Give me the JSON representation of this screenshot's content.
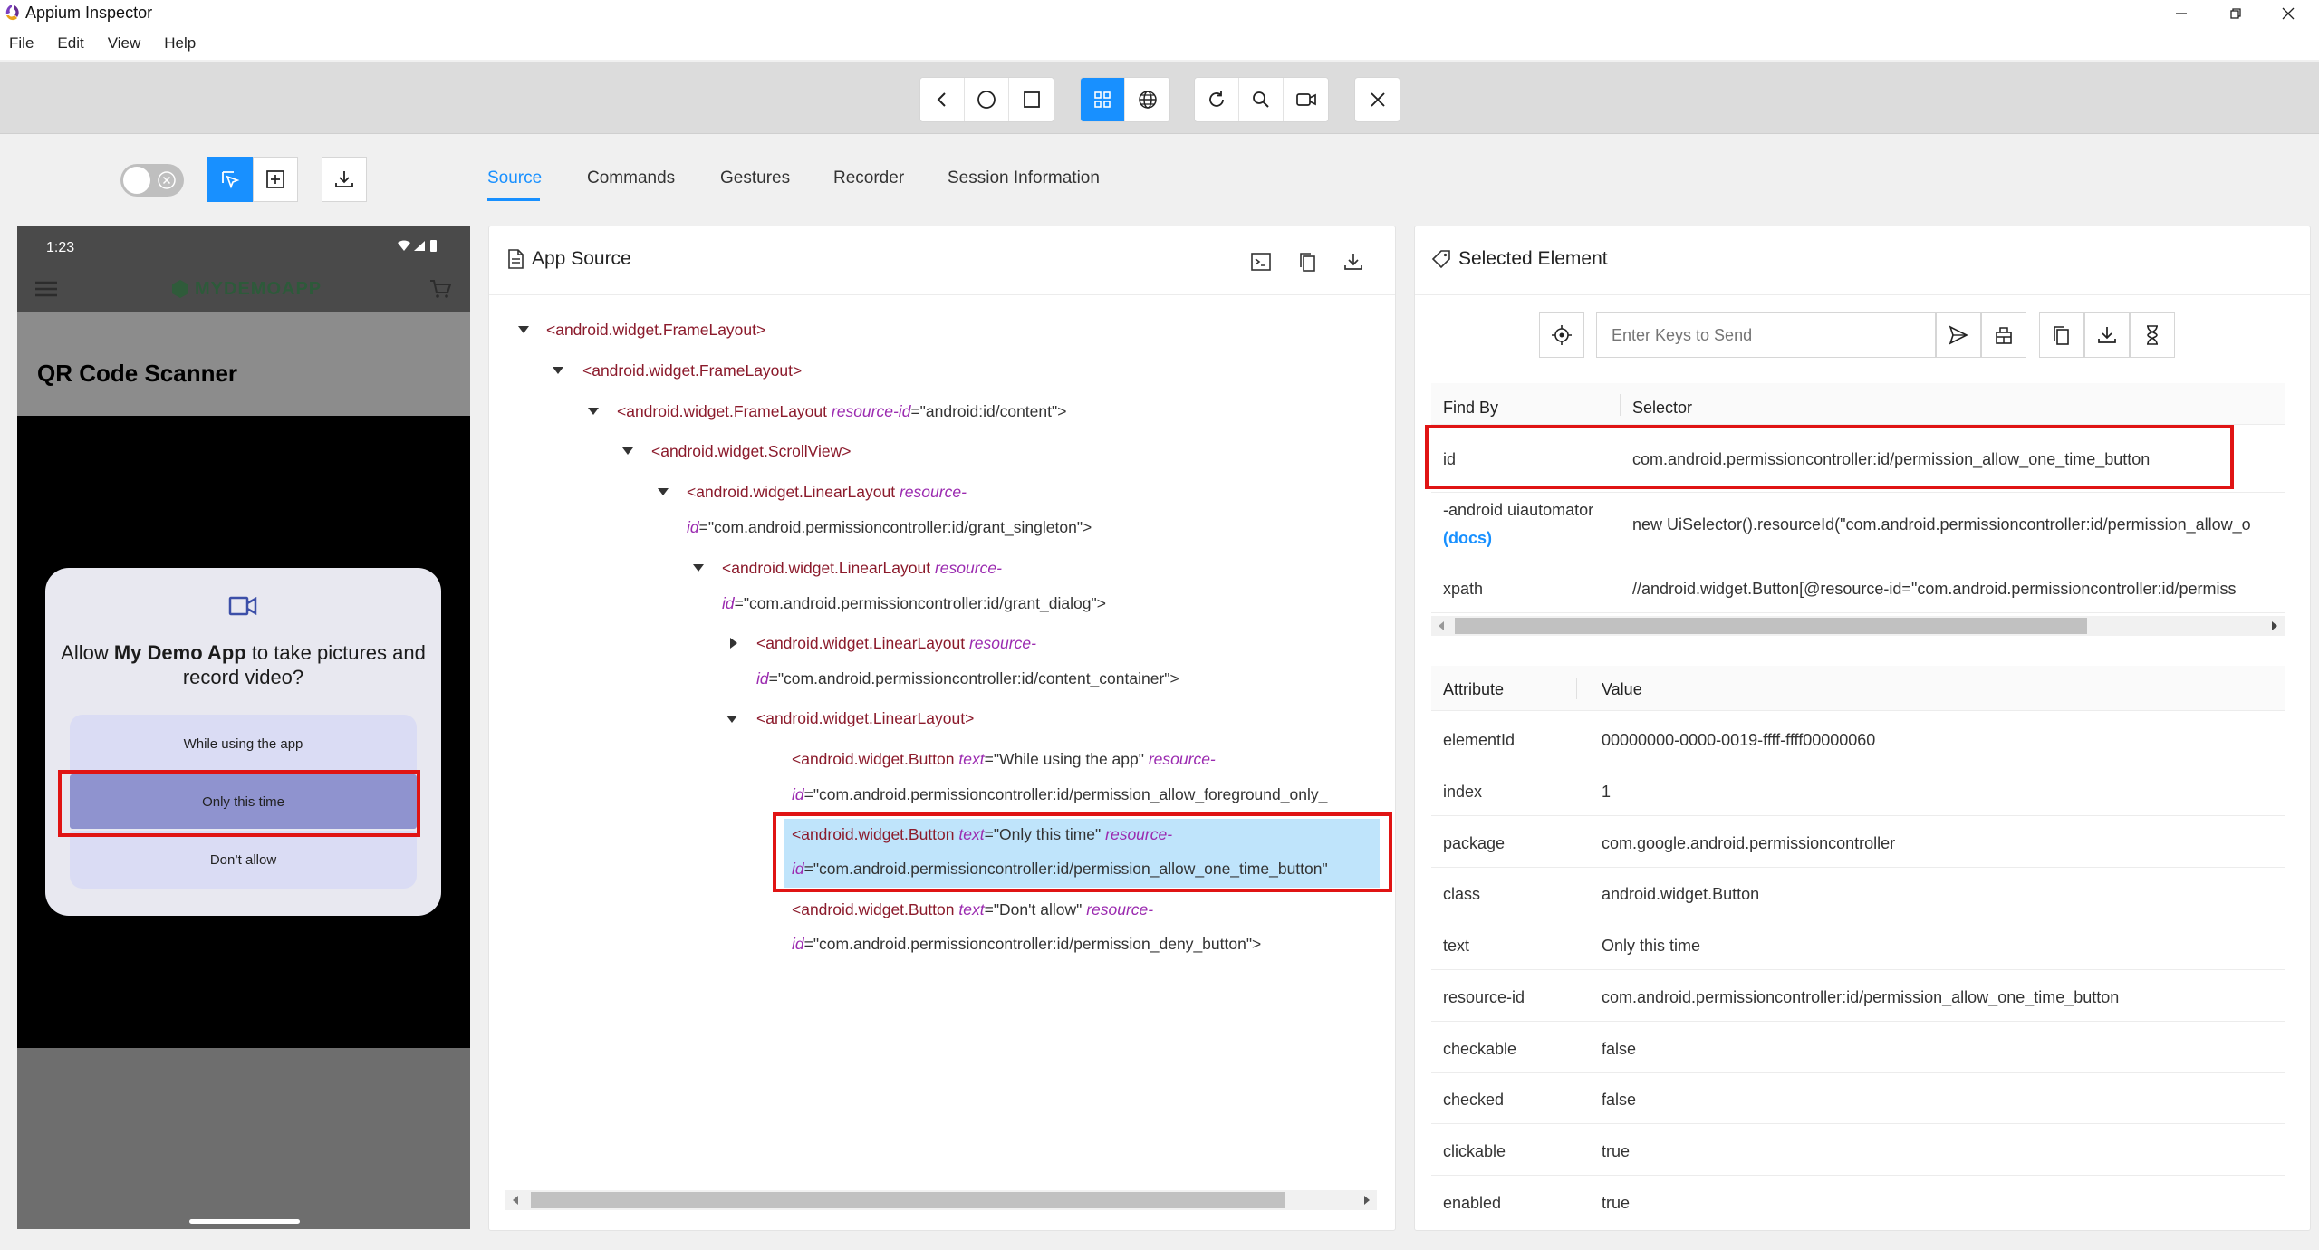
{
  "window": {
    "title": "Appium Inspector"
  },
  "menu": [
    "File",
    "Edit",
    "View",
    "Help"
  ],
  "tabs": [
    "Source",
    "Commands",
    "Gestures",
    "Recorder",
    "Session Information"
  ],
  "device": {
    "time": "1:23",
    "brand": "MYDEMOAPP",
    "screen_title": "QR Code Scanner",
    "dialog": {
      "prefix": "Allow ",
      "app_name": "My Demo App",
      "suffix": " to take pictures and record video?",
      "buttons": [
        "While using the app",
        "Only this time",
        "Don’t allow"
      ]
    }
  },
  "app_source": {
    "title": "App Source",
    "nodes": [
      {
        "tag": "<android.widget.FrameLayout>"
      },
      {
        "tag": "<android.widget.FrameLayout>"
      },
      {
        "tag": "<android.widget.FrameLayout",
        "attr": "resource-id",
        "val": "=\"android:id/content\">"
      },
      {
        "tag": "<android.widget.ScrollView>"
      },
      {
        "tag": "<android.widget.LinearLayout",
        "attr": "resource-",
        "attr2": "id",
        "val2": "=\"com.android.permissioncontroller:id/grant_singleton\">"
      },
      {
        "tag": "<android.widget.LinearLayout",
        "attr": "resource-",
        "attr2": "id",
        "val2": "=\"com.android.permissioncontroller:id/grant_dialog\">"
      },
      {
        "tag": "<android.widget.LinearLayout",
        "attr": "resource-",
        "attr2": "id",
        "val2": "=\"com.android.permissioncontroller:id/content_container\">"
      },
      {
        "tag": "<android.widget.LinearLayout>"
      },
      {
        "tag": "<android.widget.Button",
        "attr": "text",
        "val": "=\"While using the app\"",
        "attr_b": "resource-",
        "attr2": "id",
        "val2": "=\"com.android.permissioncontroller:id/permission_allow_foreground_only_"
      },
      {
        "tag": "<android.widget.Button",
        "attr": "text",
        "val": "=\"Only this time\"",
        "attr_b": "resource-",
        "attr2": "id",
        "val2": "=\"com.android.permissioncontroller:id/permission_allow_one_time_button\""
      },
      {
        "tag": "<android.widget.Button",
        "attr": "text",
        "val": "=\"Don't allow\"",
        "attr_b": "resource-",
        "attr2": "id",
        "val2": "=\"com.android.permissioncontroller:id/permission_deny_button\">"
      }
    ]
  },
  "selected_element": {
    "title": "Selected Element",
    "keys_placeholder": "Enter Keys to Send",
    "find_by_header": "Find By",
    "selector_header": "Selector",
    "selectors": [
      {
        "by": "id",
        "value": "com.android.permissioncontroller:id/permission_allow_one_time_button"
      },
      {
        "by": "-android uiautomator",
        "docs": "(docs)",
        "value": "new UiSelector().resourceId(\"com.android.permissioncontroller:id/permission_allow_o"
      },
      {
        "by": "xpath",
        "value": "//android.widget.Button[@resource-id=\"com.android.permissioncontroller:id/permiss"
      }
    ],
    "attribute_header": "Attribute",
    "value_header": "Value",
    "attributes": [
      {
        "name": "elementId",
        "value": "00000000-0000-0019-ffff-ffff00000060"
      },
      {
        "name": "index",
        "value": "1"
      },
      {
        "name": "package",
        "value": "com.google.android.permissioncontroller"
      },
      {
        "name": "class",
        "value": "android.widget.Button"
      },
      {
        "name": "text",
        "value": "Only this time"
      },
      {
        "name": "resource-id",
        "value": "com.android.permissioncontroller:id/permission_allow_one_time_button"
      },
      {
        "name": "checkable",
        "value": "false"
      },
      {
        "name": "checked",
        "value": "false"
      },
      {
        "name": "clickable",
        "value": "true"
      },
      {
        "name": "enabled",
        "value": "true"
      }
    ]
  },
  "colors": {
    "accent": "#1890ff",
    "highlight": "#e01414",
    "tag": "#8b1a2b",
    "attr": "#9b2bb0"
  }
}
